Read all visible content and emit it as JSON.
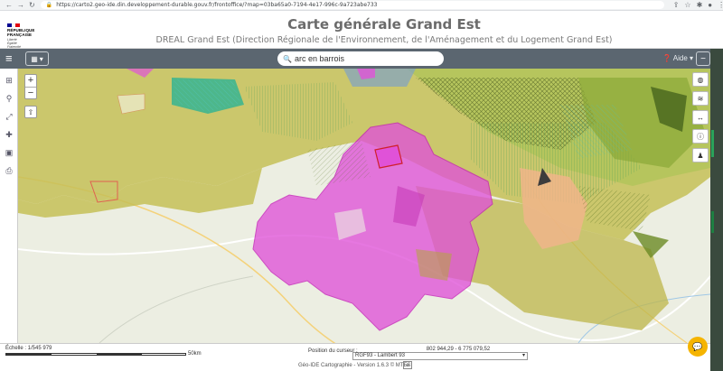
{
  "browser": {
    "url": "https://carto2.geo-ide.din.developpement-durable.gouv.fr/frontoffice/?map=03ba65a0-7194-4e17-996c-9a723abe733"
  },
  "logo": {
    "republic": "RÉPUBLIQUE",
    "republic2": "FRANÇAISE",
    "motto1": "Liberté",
    "motto2": "Égalité",
    "motto3": "Fraternité",
    "colors": [
      "#000091",
      "#ffffff",
      "#e1000f"
    ]
  },
  "header": {
    "title": "Carte générale Grand Est",
    "subtitle": "DREAL Grand Est (Direction Régionale de l'Environnement, de l'Aménagement et du Logement Grand Est)"
  },
  "toolbar": {
    "menu_icon": "menu-icon",
    "search_value": "arc en barrois",
    "help_label": "Aide",
    "accent": "#5b6670"
  },
  "status": {
    "scale_label": "Échelle : 1/545 979",
    "scale_max": "50km",
    "cursor_label": "Position du curseur :",
    "coordinates": "802 944,29 - 6 775 079,52",
    "projection": "RGF93 - Lambert 93"
  },
  "footer": {
    "version": "Géo-IDE Cartographie - Version 1.6.3 © MTES"
  }
}
